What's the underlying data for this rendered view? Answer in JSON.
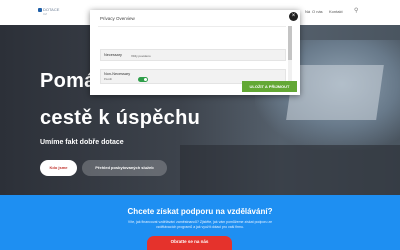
{
  "header": {
    "logo_text": "DOTACE",
    "logo_sub": "CZ",
    "nav": [
      "Ná",
      "O nás",
      "Kontakt"
    ],
    "search_icon": "search-icon"
  },
  "hero": {
    "title_line1": "Pomá",
    "title_line2": "cestě k úspěchu",
    "subtitle": "Umíme fakt dobře dotace",
    "btn_about": "Kdo jsme",
    "btn_services": "Přehled poskytovaných služeb"
  },
  "band": {
    "title": "Chcete získat podporu na vzdělávání?",
    "text1": "Víte, jak financovat vzdělávání zaměstnanců? Zjistěte, jak vám pomůžeme získat podporu ze",
    "text2": "vzdělávacích programů a jak využít dotaci pro vaši firmu.",
    "button": "Obratte se na nás"
  },
  "modal": {
    "title": "Privacy Overview",
    "close_icon": "close-icon",
    "necessary_label": "Necessary",
    "necessary_status": "Vždy povoleno",
    "non_necessary_label": "Non-Necessary",
    "toggle_text": "Povolit",
    "toggle_on": true,
    "save_button": "ULOŽIT A PŘIJMOUT",
    "accent": "#63a835"
  },
  "colors": {
    "band": "#1e8ff2",
    "cta_red": "#e5322c",
    "toggle": "#2f9e4a"
  }
}
